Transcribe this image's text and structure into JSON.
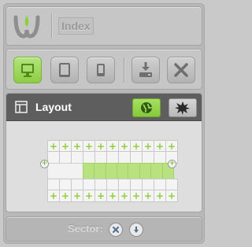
{
  "header": {
    "logo_icon": "w-leaf-logo-icon",
    "title": "Index"
  },
  "toolbar": {
    "buttons": [
      {
        "icon": "desktop-icon",
        "active": true
      },
      {
        "icon": "tablet-icon",
        "active": false
      },
      {
        "icon": "phone-icon",
        "active": false
      },
      {
        "icon": "download-icon",
        "active": false
      },
      {
        "icon": "close-icon",
        "active": false
      }
    ]
  },
  "layout_panel": {
    "title": "Layout",
    "title_icon": "layout-icon",
    "globe_button_icon": "globe-icon",
    "settings_button_icon": "star-icon",
    "add_glyph": "+"
  },
  "footer": {
    "label": "Sector:",
    "buttons": [
      {
        "icon": "close-circle-icon"
      },
      {
        "icon": "arrow-down-circle-icon"
      }
    ]
  },
  "colors": {
    "accent": "#96d34a",
    "header_bg": "#5e5e5e",
    "panel_bg": "#b8b8b8"
  }
}
